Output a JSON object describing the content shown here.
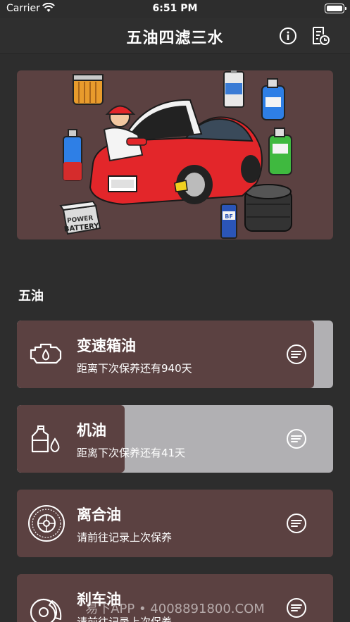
{
  "status_bar": {
    "carrier": "Carrier",
    "time": "6:51 PM",
    "battery_percent": 100
  },
  "nav": {
    "title": "五油四滤三水",
    "info_icon": "info-circle-icon",
    "history_icon": "maintenance-log-icon"
  },
  "banner": {
    "illustration": "mechanic-repairing-red-car",
    "battery_label": "BATTERY",
    "power_label": "POWER",
    "brake_fluid_label": "BF"
  },
  "section": {
    "title": "五油"
  },
  "items": [
    {
      "name": "变速箱油",
      "status": "距离下次保养还有940天",
      "icon": "transmission-icon",
      "remaining_fraction": 0.94
    },
    {
      "name": "机油",
      "status": "距离下次保养还有41天",
      "icon": "engine-oil-icon",
      "remaining_fraction": 0.34
    },
    {
      "name": "离合油",
      "status": "请前往记录上次保养",
      "icon": "clutch-icon",
      "remaining_fraction": 1.0
    },
    {
      "name": "刹车油",
      "status": "请前往记录上次保养",
      "icon": "brake-icon",
      "remaining_fraction": 1.0
    }
  ],
  "watermark": "易下APP • 4008891800.COM",
  "colors": {
    "background": "#2d2d2d",
    "card": "#5b4141",
    "card_track": "#b1b0b3",
    "text": "#ffffff"
  }
}
